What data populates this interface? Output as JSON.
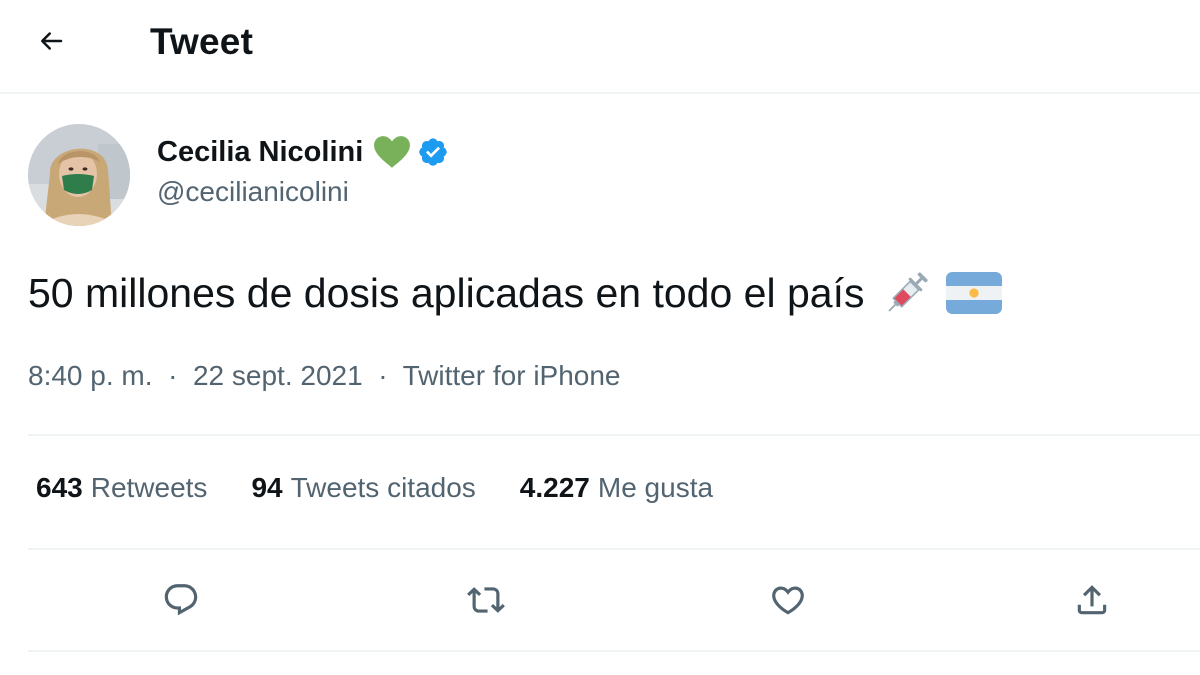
{
  "header": {
    "title": "Tweet",
    "back_icon": "arrow-left-icon"
  },
  "author": {
    "display_name": "Cecilia Nicolini",
    "handle": "@cecilianicolini",
    "name_emoji": "green-heart-icon",
    "verified_icon": "verified-badge-icon"
  },
  "tweet": {
    "text": "50 millones de dosis aplicadas en todo el país",
    "emojis": [
      "syringe-icon",
      "argentina-flag-icon"
    ],
    "time": "8:40 p. m.",
    "date": "22 sept. 2021",
    "source": "Twitter for iPhone",
    "separator": "·"
  },
  "stats": [
    {
      "count": "643",
      "label": "Retweets"
    },
    {
      "count": "94",
      "label": "Tweets citados"
    },
    {
      "count": "4.227",
      "label": "Me gusta"
    }
  ],
  "actions": [
    "reply-icon",
    "retweet-icon",
    "like-icon",
    "share-icon"
  ],
  "colors": {
    "text_primary": "#0f1419",
    "text_secondary": "#536471",
    "divider": "#eff3f4",
    "verified_blue": "#1d9bf0",
    "heart_green": "#78b159"
  }
}
